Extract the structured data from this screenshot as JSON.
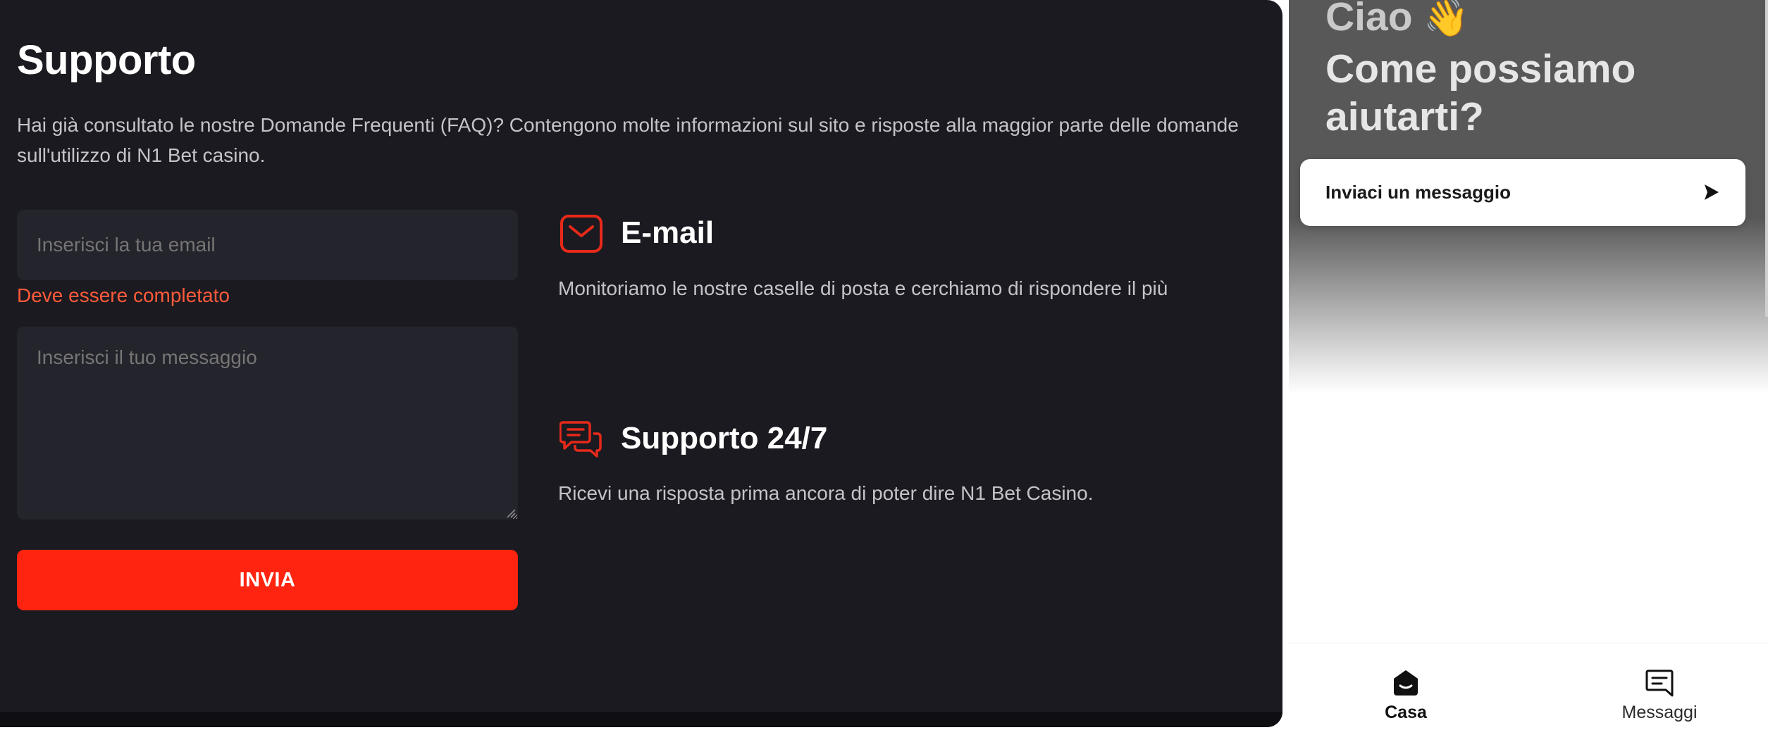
{
  "support": {
    "title": "Supporto",
    "intro": "Hai già consultato le nostre Domande Frequenti (FAQ)? Contengono molte informazioni sul sito e risposte alla maggior parte delle domande sull'utilizzo di N1 Bet casino.",
    "form": {
      "email_placeholder": "Inserisci la tua email",
      "email_value": "",
      "email_error": "Deve essere completato",
      "message_placeholder": "Inserisci il tuo messaggio",
      "message_value": "",
      "submit_label": "INVIA"
    },
    "info": [
      {
        "icon": "mail-icon",
        "title": "E-mail",
        "text": "Monitoriamo le nostre caselle di posta e cerchiamo di rispondere il più"
      },
      {
        "icon": "chat-bubbles-icon",
        "title": "Supporto 24/7",
        "text": "Ricevi una risposta prima ancora di poter dire N1 Bet Casino."
      }
    ]
  },
  "widget": {
    "greeting": "Ciao",
    "greeting_emoji": "👋",
    "help_line1": "Come possiamo",
    "help_line2": "aiutarti?",
    "send_message_label": "Inviaci un messaggio",
    "nav": [
      {
        "label": "Casa",
        "icon": "home-icon",
        "active": true
      },
      {
        "label": "Messaggi",
        "icon": "messages-icon",
        "active": false
      }
    ]
  },
  "colors": {
    "panel_bg": "#1a1a20",
    "input_bg": "#24242c",
    "accent_red": "#ff2410",
    "error_text": "#ff5a3a",
    "widget_header": "#585858"
  }
}
